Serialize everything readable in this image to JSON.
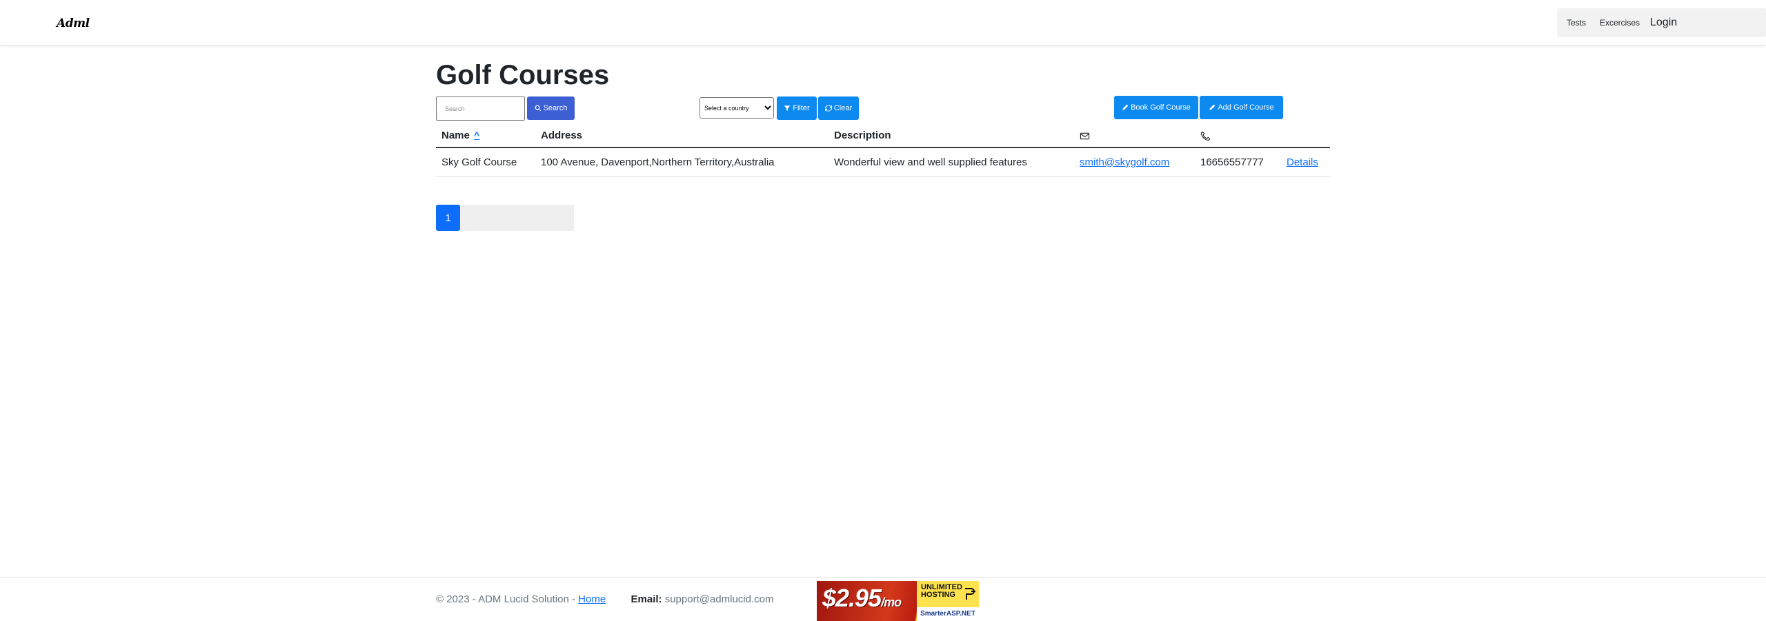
{
  "navbar": {
    "brand": "Adml",
    "links": {
      "tests": "Tests",
      "exercises": "Excercises",
      "login": "Login"
    }
  },
  "page": {
    "title": "Golf Courses"
  },
  "toolbar": {
    "search_placeholder": "Search",
    "search_button": "Search",
    "country_select": {
      "selected": "Select a country"
    },
    "filter_button": "Filter",
    "clear_button": "Clear",
    "book_button": "Book Golf Course",
    "add_button": "Add Golf Course"
  },
  "table": {
    "headers": {
      "name": "Name",
      "sort_indicator": "^",
      "address": "Address",
      "description": "Description",
      "email_icon": "envelope-icon",
      "phone_icon": "phone-icon"
    },
    "rows": [
      {
        "name": "Sky Golf Course",
        "address": "100 Avenue, Davenport,Northern Territory,Australia",
        "description": "Wonderful view and well supplied features",
        "email": "smith@skygolf.com",
        "phone": "16656557777",
        "details": "Details"
      }
    ]
  },
  "pagination": {
    "current": "1"
  },
  "footer": {
    "copyright": "© 2023 - ADM Lucid Solution - ",
    "home_link": "Home",
    "email_label": "Email:",
    "email_value": " support@admlucid.com",
    "ad": {
      "price": "$2.95",
      "per": "/mo",
      "headline": "UNLIMITED HOSTING",
      "brand": "SmarterASP.NET"
    }
  },
  "colors": {
    "primary": "#0d6efd",
    "button_blue": "#0d8af0",
    "search_button": "#3d5fd4"
  }
}
